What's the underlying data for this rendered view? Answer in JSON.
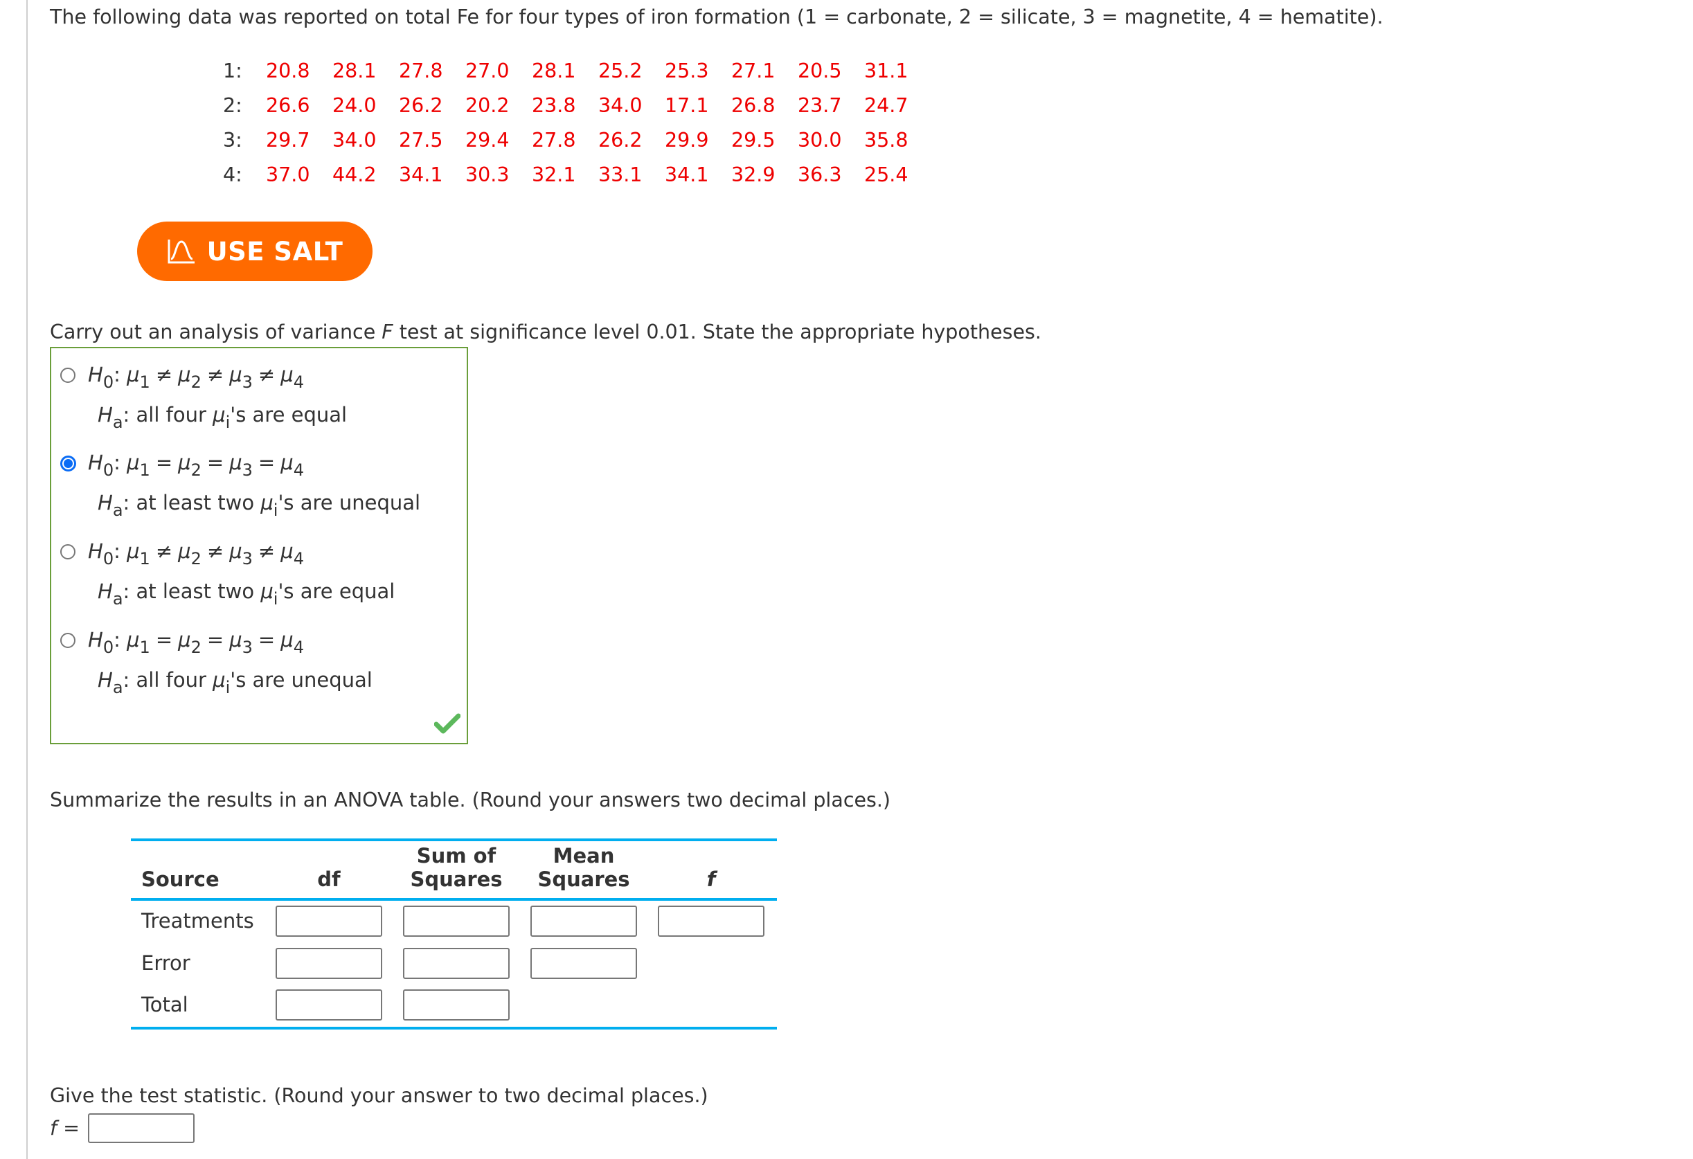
{
  "intro": {
    "text": "The following data was reported on total Fe for four types of iron formation (1 = carbonate, 2 = silicate, 3 = magnetite, 4 = hematite)."
  },
  "data_table": {
    "value_color": "#ee0000",
    "rows": [
      {
        "label": "1:",
        "values": [
          "20.8",
          "28.1",
          "27.8",
          "27.0",
          "28.1",
          "25.2",
          "25.3",
          "27.1",
          "20.5",
          "31.1"
        ]
      },
      {
        "label": "2:",
        "values": [
          "26.6",
          "24.0",
          "26.2",
          "20.2",
          "23.8",
          "34.0",
          "17.1",
          "26.8",
          "23.7",
          "24.7"
        ]
      },
      {
        "label": "3:",
        "values": [
          "29.7",
          "34.0",
          "27.5",
          "29.4",
          "27.8",
          "26.2",
          "29.9",
          "29.5",
          "30.0",
          "35.8"
        ]
      },
      {
        "label": "4:",
        "values": [
          "37.0",
          "44.2",
          "34.1",
          "30.3",
          "32.1",
          "33.1",
          "34.1",
          "32.9",
          "36.3",
          "25.4"
        ]
      }
    ]
  },
  "salt_button": {
    "label": "USE SALT",
    "icon": "bell-curve-chart-icon",
    "color": "#ff6a00"
  },
  "hypotheses": {
    "prompt_before": "Carry out an analysis of variance ",
    "prompt_var": "F",
    "prompt_after": " test at significance level 0.01. State the appropriate hypotheses.",
    "h0_label": "H",
    "h0_sub": "0",
    "ha_label": "H",
    "ha_sub": "a",
    "mu": "μ",
    "mu_i_sub": "i",
    "selected_index": 1,
    "correct_icon": "checkmark-icon",
    "options": [
      {
        "op": "≠",
        "ha_before": ": all four ",
        "ha_after": "'s are equal"
      },
      {
        "op": "=",
        "ha_before": ": at least two ",
        "ha_after": "'s are unequal"
      },
      {
        "op": "≠",
        "ha_before": ": at least two ",
        "ha_after": "'s are equal"
      },
      {
        "op": "=",
        "ha_before": ": all four ",
        "ha_after": "'s are unequal"
      }
    ]
  },
  "anova": {
    "prompt": "Summarize the results in an ANOVA table. (Round your answers two decimal places.)",
    "headers": {
      "source": "Source",
      "df": "df",
      "ss_line1": "Sum of",
      "ss_line2": "Squares",
      "ms_line1": "Mean",
      "ms_line2": "Squares",
      "f": "f"
    },
    "rows": [
      {
        "label": "Treatments",
        "df": "",
        "ss": "",
        "ms": "",
        "f": ""
      },
      {
        "label": "Error",
        "df": "",
        "ss": "",
        "ms": ""
      },
      {
        "label": "Total",
        "df": "",
        "ss": ""
      }
    ],
    "rule_color": "#00aeef"
  },
  "test_statistic": {
    "prompt": "Give the test statistic. (Round your answer to two decimal places.)",
    "label_var": "f",
    "label_eq": "=",
    "value": ""
  }
}
